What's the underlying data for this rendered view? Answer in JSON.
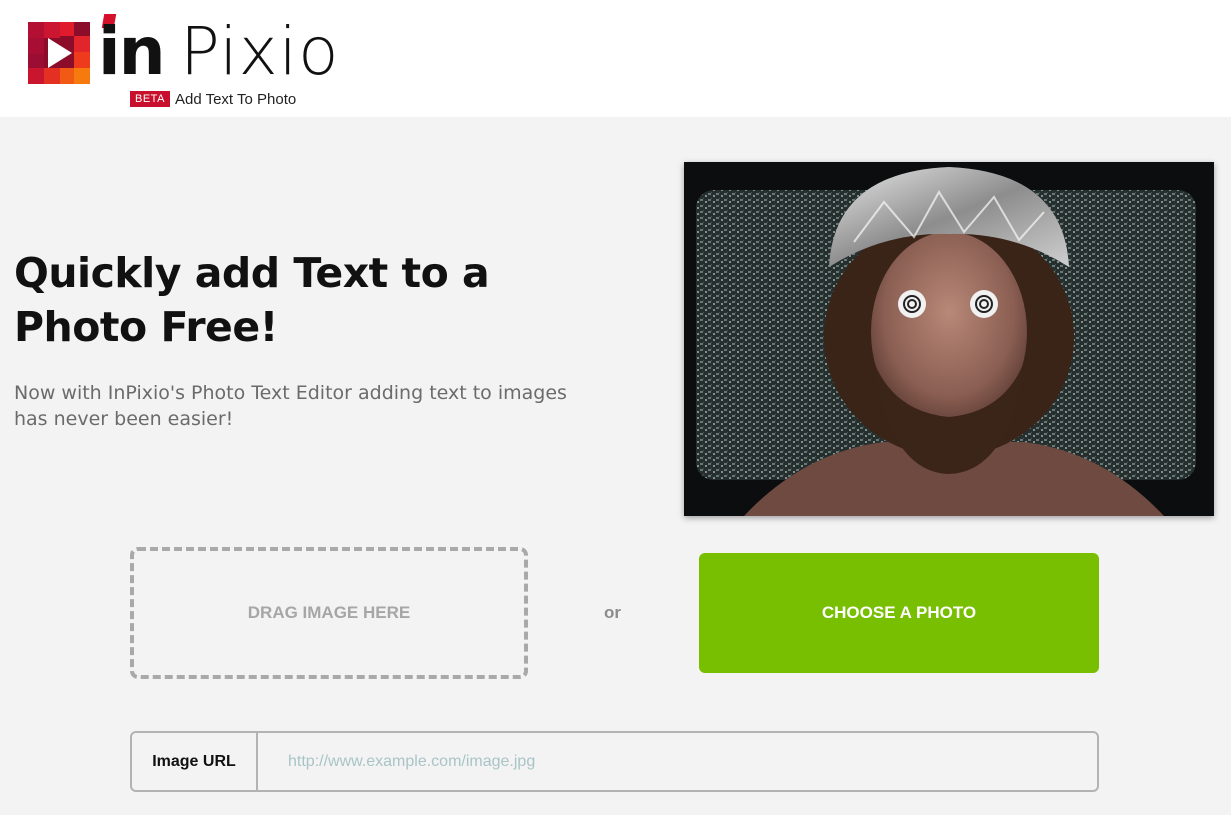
{
  "header": {
    "logo_in": "in",
    "logo_pixio": "Pixio",
    "badge": "BETA",
    "subtitle": "Add Text To Photo"
  },
  "hero": {
    "headline": "Quickly add Text to a Photo Free!",
    "lede": "Now with InPixio's Photo Text Editor adding text to images has never been easier!"
  },
  "upload": {
    "drag_label": "DRAG IMAGE HERE",
    "or_label": "or",
    "choose_label": "CHOOSE A PHOTO",
    "url_label": "Image URL",
    "url_placeholder": "http://www.example.com/image.jpg",
    "url_value": ""
  },
  "colors": {
    "brand_red": "#c8102e",
    "choose_green": "#77bf00"
  },
  "icons": {
    "logo_mark": "play-icon"
  }
}
